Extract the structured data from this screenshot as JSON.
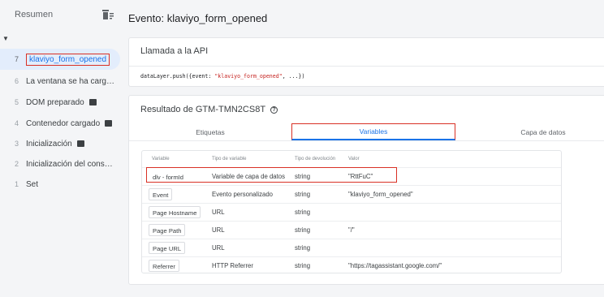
{
  "sidebar": {
    "title": "Resumen",
    "clear_icon": "clear-list-icon",
    "items": [
      {
        "num": "7",
        "label": "klaviyo_form_opened",
        "badge": false
      },
      {
        "num": "6",
        "label": "La ventana se ha cargad...",
        "badge": false
      },
      {
        "num": "5",
        "label": "DOM preparado",
        "badge": true
      },
      {
        "num": "4",
        "label": "Contenedor cargado",
        "badge": true
      },
      {
        "num": "3",
        "label": "Inicialización",
        "badge": true
      },
      {
        "num": "2",
        "label": "Inicialización del consen...",
        "badge": false
      },
      {
        "num": "1",
        "label": "Set",
        "badge": false
      }
    ]
  },
  "main": {
    "title": "Evento: klaviyo_form_opened",
    "api_card": {
      "title": "Llamada a la API",
      "code_prefix": "dataLayer.push({event: ",
      "code_string": "\"klaviyo_form_opened\"",
      "code_suffix": ", ...})"
    },
    "result_card": {
      "title": "Resultado de GTM-TMN2CS8T",
      "help_icon": "help-icon",
      "tabs": [
        "Etiquetas",
        "Variables",
        "Capa de datos"
      ],
      "active_tab": "Variables",
      "columns": [
        "Variable",
        "Tipo de variable",
        "Tipo de devolución",
        "Valor"
      ],
      "rows": [
        {
          "variable": "dlv - formId",
          "type": "Variable de capa de datos",
          "return": "string",
          "value": "\"RttFuC\""
        },
        {
          "variable": "Event",
          "type": "Evento personalizado",
          "return": "string",
          "value": "\"klaviyo_form_opened\""
        },
        {
          "variable": "Page Hostname",
          "type": "URL",
          "return": "string",
          "value": ""
        },
        {
          "variable": "Page Path",
          "type": "URL",
          "return": "string",
          "value": "\"/\""
        },
        {
          "variable": "Page URL",
          "type": "URL",
          "return": "string",
          "value": ""
        },
        {
          "variable": "Referrer",
          "type": "HTTP Referrer",
          "return": "string",
          "value": "\"https://tagassistant.google.com/\""
        }
      ]
    }
  },
  "colors": {
    "accent": "#1a73e8",
    "highlight": "#d93025",
    "background": "#f4f5f7"
  }
}
